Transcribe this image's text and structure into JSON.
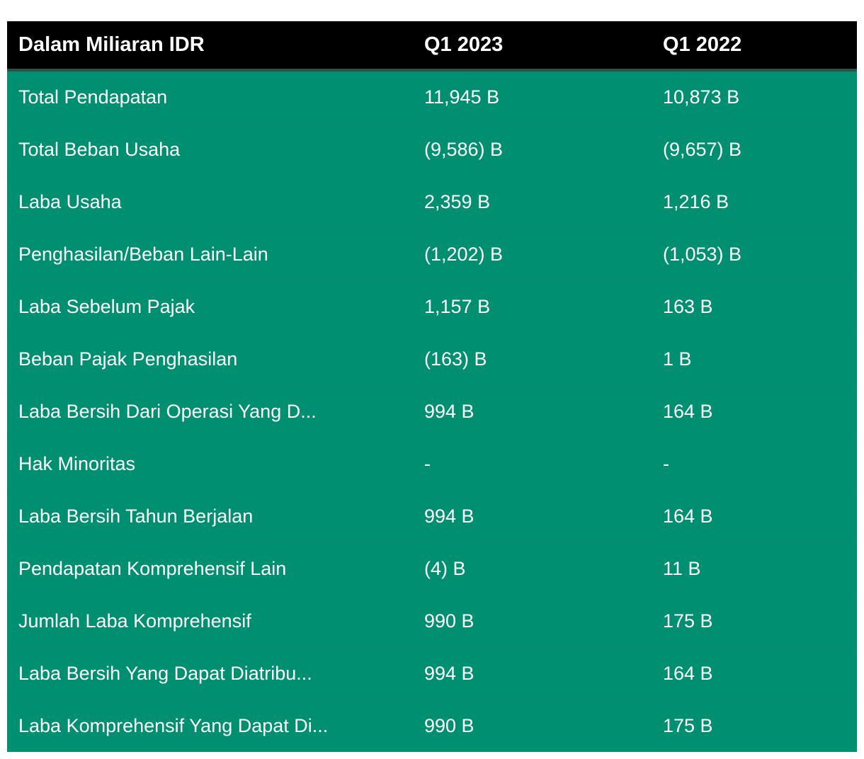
{
  "colors": {
    "header_bg": "#000000",
    "row_bg": "#008f70",
    "text": "#ffffff"
  },
  "chart_data": {
    "type": "table",
    "columns": [
      "Dalam Miliaran IDR",
      "Q1 2023",
      "Q1 2022"
    ],
    "rows": [
      [
        "Total Pendapatan",
        "11,945 B",
        "10,873 B"
      ],
      [
        "Total Beban Usaha",
        "(9,586) B",
        "(9,657) B"
      ],
      [
        "Laba Usaha",
        "2,359 B",
        "1,216 B"
      ],
      [
        "Penghasilan/Beban Lain-Lain",
        "(1,202) B",
        "(1,053) B"
      ],
      [
        "Laba Sebelum Pajak",
        "1,157 B",
        "163 B"
      ],
      [
        "Beban Pajak Penghasilan",
        "(163) B",
        "1 B"
      ],
      [
        "Laba Bersih Dari Operasi Yang D...",
        "994 B",
        "164 B"
      ],
      [
        "Hak Minoritas",
        "-",
        "-"
      ],
      [
        "Laba Bersih Tahun Berjalan",
        "994 B",
        "164 B"
      ],
      [
        "Pendapatan Komprehensif Lain",
        "(4) B",
        "11 B"
      ],
      [
        "Jumlah Laba Komprehensif",
        "990 B",
        "175 B"
      ],
      [
        "Laba Bersih Yang Dapat Diatribu...",
        "994 B",
        "164 B"
      ],
      [
        "Laba Komprehensif Yang Dapat Di...",
        "990 B",
        "175 B"
      ]
    ]
  }
}
